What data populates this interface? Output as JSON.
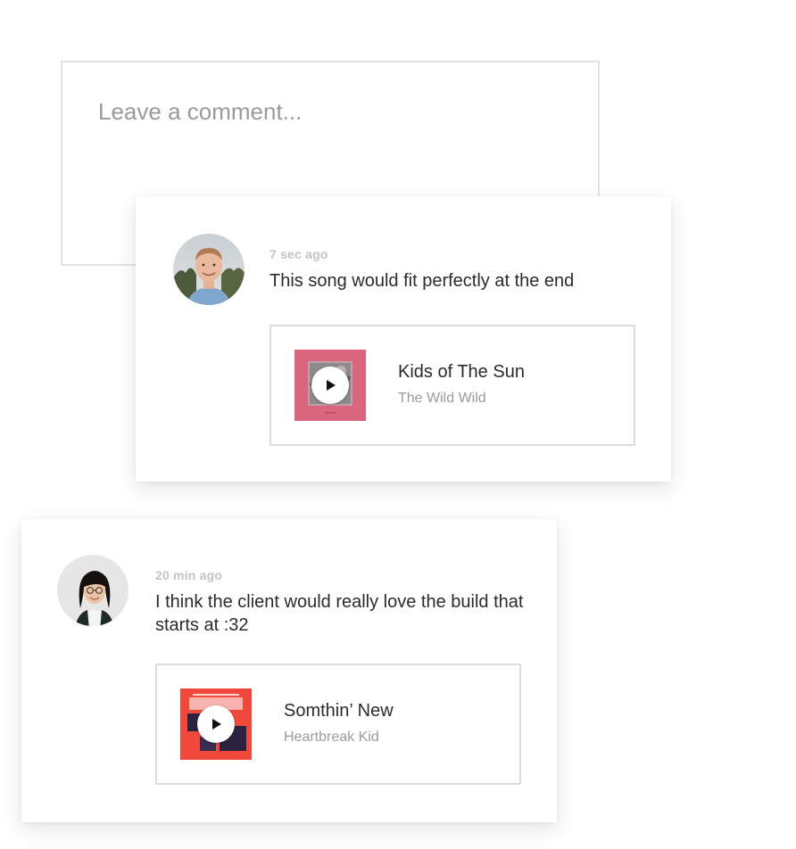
{
  "comment_input": {
    "placeholder": "Leave a comment..."
  },
  "comments": [
    {
      "timestamp": "7 sec ago",
      "text": "This song would fit perfectly at the end",
      "track": {
        "title": "Kids of The Sun",
        "artist": "The Wild Wild",
        "cover_color": "#d9657f"
      }
    },
    {
      "timestamp": "20 min ago",
      "text": "I think the client would really love the build that starts at :32",
      "track": {
        "title": "Somthin’ New",
        "artist": "Heartbreak Kid",
        "cover_color": "#f0493b"
      }
    }
  ],
  "icons": {
    "play": "play-icon"
  }
}
